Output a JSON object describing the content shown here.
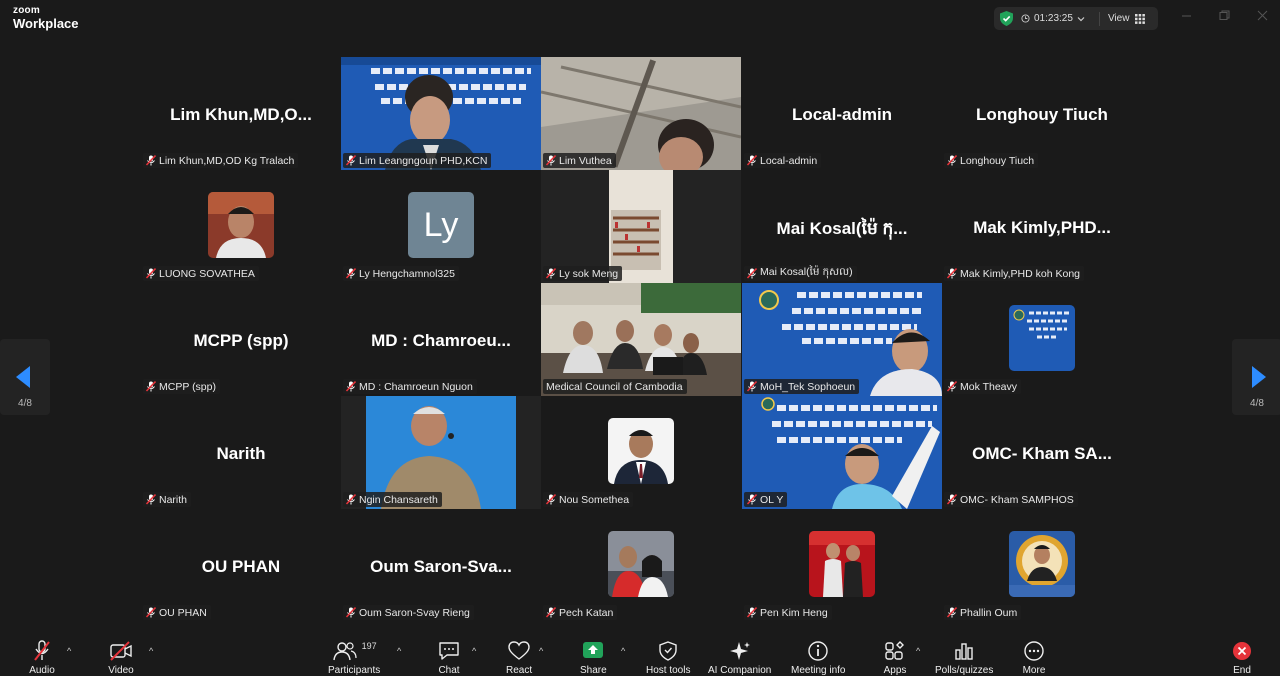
{
  "app": {
    "brand_top": "zoom",
    "brand_bottom": "Workplace"
  },
  "status": {
    "timer": "01:23:25",
    "view_label": "View"
  },
  "pagination": {
    "left": "4/8",
    "right": "4/8"
  },
  "tiles": [
    {
      "big": "Lim  Khun,MD,O...",
      "tag": "Lim Khun,MD,OD Kg Tralach"
    },
    {
      "big": "",
      "tag": "Lim Leangngoun PHD,KCN"
    },
    {
      "big": "",
      "tag": "Lim Vuthea"
    },
    {
      "big": "Local-admin",
      "tag": "Local-admin"
    },
    {
      "big": "Longhouy  Tiuch",
      "tag": "Longhouy Tiuch"
    },
    {
      "big": "",
      "tag": "LUONG SOVATHEA"
    },
    {
      "big": "",
      "tag": "Ly Hengchamnol325",
      "initials": "Ly"
    },
    {
      "big": "",
      "tag": "Ly sok Meng"
    },
    {
      "big": "Mai  Kosal(ម៉ៃ កុ...",
      "tag": "Mai Kosal(ម៉ៃ កុសល)"
    },
    {
      "big": "Mak  Kimly,PHD...",
      "tag": "Mak Kimly,PHD koh Kong"
    },
    {
      "big": "MCPP (spp)",
      "tag": "MCPP (spp)"
    },
    {
      "big": "MD : Chamroeu...",
      "tag": "MD : Chamroeun Nguon"
    },
    {
      "big": "",
      "tag": "Medical Council of Cambodia"
    },
    {
      "big": "",
      "tag": "MoH_Tek Sophoeun"
    },
    {
      "big": "",
      "tag": "Mok Theavy"
    },
    {
      "big": "Narith",
      "tag": "Narith"
    },
    {
      "big": "",
      "tag": "Ngin Chansareth"
    },
    {
      "big": "",
      "tag": "Nou Somethea"
    },
    {
      "big": "",
      "tag": "OL Y"
    },
    {
      "big": "OMC- Kham  SA...",
      "tag": "OMC- Kham SAMPHOS"
    },
    {
      "big": "OU PHAN",
      "tag": "OU PHAN"
    },
    {
      "big": "Oum  Saron-Sva...",
      "tag": "Oum Saron-Svay Rieng"
    },
    {
      "big": "",
      "tag": "Pech Katan"
    },
    {
      "big": "",
      "tag": "Pen Kim Heng"
    },
    {
      "big": "",
      "tag": "Phallin Oum"
    }
  ],
  "toolbar": {
    "audio": "Audio",
    "video": "Video",
    "participants": "Participants",
    "participants_count": "197",
    "chat": "Chat",
    "react": "React",
    "share": "Share",
    "host_tools": "Host tools",
    "ai_companion": "AI Companion",
    "meeting_info": "Meeting info",
    "apps": "Apps",
    "polls": "Polls/quizzes",
    "more": "More",
    "end": "End"
  },
  "colors": {
    "accent_green": "#21a35a",
    "end_red": "#e5333a",
    "nav_blue": "#2d8cff",
    "banner_blue": "#1f5bb5"
  }
}
